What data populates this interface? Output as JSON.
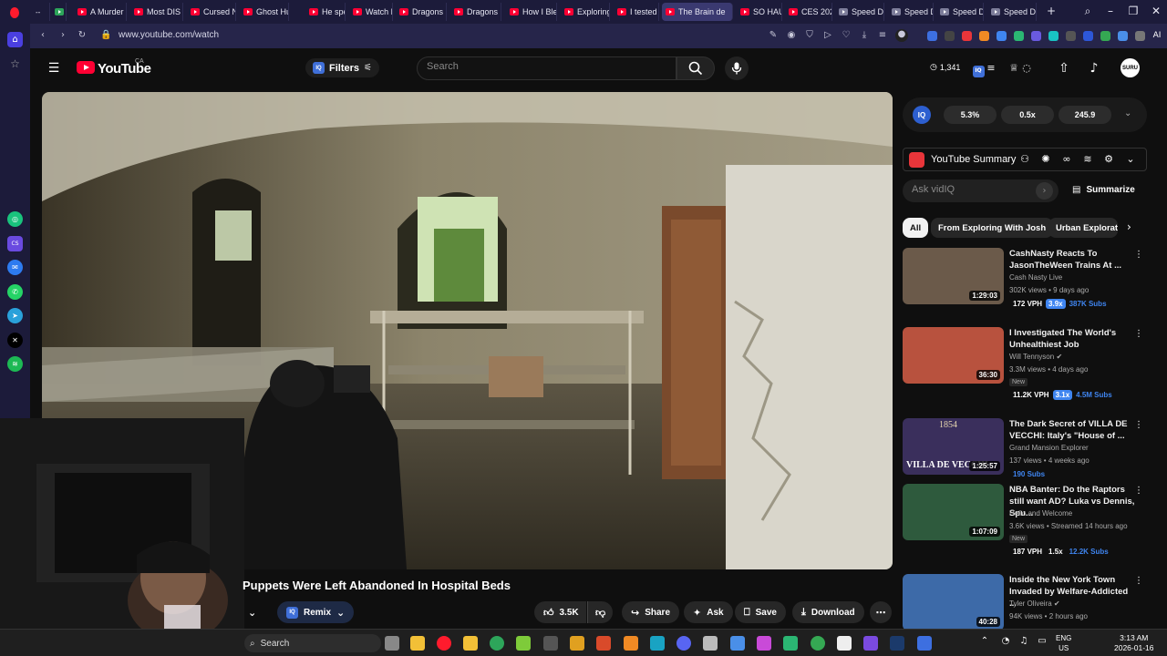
{
  "browser": {
    "tabs": [
      {
        "title": "A Murder",
        "active": false
      },
      {
        "title": "Most DIS",
        "active": false
      },
      {
        "title": "Cursed N",
        "active": false
      },
      {
        "title": "Ghost Hu",
        "active": false
      },
      {
        "title": "He spent",
        "active": false
      },
      {
        "title": "Watch De",
        "active": false
      },
      {
        "title": "Dragons",
        "active": false
      },
      {
        "title": "Dragons",
        "active": false
      },
      {
        "title": "How I Ble",
        "active": false
      },
      {
        "title": "Exploring",
        "active": false
      },
      {
        "title": "I tested e",
        "active": false
      },
      {
        "title": "The Brain de",
        "active": true
      },
      {
        "title": "SO HAUN",
        "active": false
      },
      {
        "title": "CES 2026",
        "active": false
      },
      {
        "title": "Speed Dir",
        "active": false
      },
      {
        "title": "Speed Dir",
        "active": false
      },
      {
        "title": "Speed Dir",
        "active": false
      },
      {
        "title": "Speed Dir",
        "active": false
      }
    ],
    "url": "www.youtube.com/watch",
    "ai_label": "AI"
  },
  "header": {
    "logo_text": "YouTube",
    "region": "CA",
    "filters_label": "Filters",
    "search_placeholder": "Search",
    "history_count": "1,341",
    "avatar_text": "SURU"
  },
  "video": {
    "title": "Puppets Were Left Abandoned In Hospital Beds",
    "remix_label": "Remix",
    "like_count": "3.5K",
    "share_label": "Share",
    "ask_label": "Ask",
    "save_label": "Save",
    "download_label": "Download"
  },
  "iq_stats": {
    "stat1": "5.3%",
    "stat2": "0.5x",
    "stat3": "245.9"
  },
  "summary": {
    "title": "YouTube Summary",
    "ask_placeholder": "Ask vidIQ",
    "summarize_label": "Summarize"
  },
  "chips": [
    {
      "label": "All",
      "active": true
    },
    {
      "label": "From Exploring With Josh",
      "active": false
    },
    {
      "label": "Urban Explorat",
      "active": false
    }
  ],
  "recommendations": [
    {
      "title": "CashNasty Reacts To JasonTheWeen Trains At ...",
      "channel": "Cash Nasty Live",
      "verified": false,
      "meta": "302K views • 9 days ago",
      "duration": "1:29:03",
      "is_new": false,
      "vph": "172 VPH",
      "mult": "3.9x",
      "subs": "387K Subs",
      "thumb_color": "#6b5a4a"
    },
    {
      "title": "I Investigated The World's Unhealthiest Job",
      "channel": "Will Tennyson",
      "verified": true,
      "meta": "3.3M views • 4 days ago",
      "duration": "36:30",
      "is_new": true,
      "new_label": "New",
      "vph": "11.2K VPH",
      "mult": "3.1x",
      "subs": "4.5M Subs",
      "thumb_color": "#b8523e"
    },
    {
      "title": "The Dark Secret of VILLA DE VECCHI: Italy's \"House of ...",
      "channel": "Grand Mansion Explorer",
      "verified": false,
      "meta": "137 views • 4 weeks ago",
      "duration": "1:25:57",
      "is_new": false,
      "vph": "",
      "mult": "",
      "subs": "190 Subs",
      "thumb_color": "#3a2f5c",
      "thumb_text": "VILLA DE VECCHI",
      "thumb_year": "1854"
    },
    {
      "title": "NBA Banter: Do the Raptors still want AD? Luka vs Dennis, Spu...",
      "channel": "Hello and Welcome",
      "verified": false,
      "meta": "3.6K views • Streamed 14 hours ago",
      "duration": "1:07:09",
      "is_new": true,
      "new_label": "New",
      "vph": "187 VPH",
      "mult": "1.5x",
      "subs": "12.2K Subs",
      "thumb_color": "#2e5a3d"
    },
    {
      "title": "Inside the New York Town Invaded by Welfare-Addicted ...",
      "channel": "Tyler Oliveira",
      "verified": true,
      "meta": "94K views • 2 hours ago",
      "duration": "40:28",
      "is_new": false,
      "vph": "",
      "mult": "",
      "subs": "",
      "thumb_color": "#3d6aa8"
    }
  ],
  "taskbar": {
    "search_label": "Search",
    "lang_top": "ENG",
    "lang_bottom": "US",
    "time": "3:13 AM",
    "date": "2026-01-16"
  },
  "colors": {
    "brand_red": "#ff0033",
    "opera_bg": "#1c1b3a",
    "accent_blue": "#3f85f0"
  }
}
